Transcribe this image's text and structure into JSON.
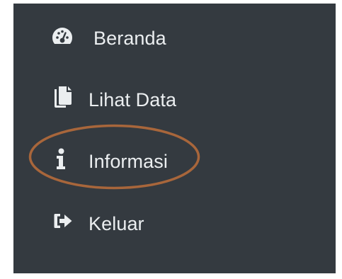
{
  "sidebar": {
    "items": [
      {
        "label": "Beranda",
        "icon": "tachometer-icon"
      },
      {
        "label": "Lihat Data",
        "icon": "copy-files-icon"
      },
      {
        "label": "Informasi",
        "icon": "info-icon"
      },
      {
        "label": "Keluar",
        "icon": "sign-out-icon"
      }
    ]
  },
  "colors": {
    "sidebar_bg": "#343a40",
    "text": "#ebeef0",
    "highlight": "#a8663b"
  }
}
